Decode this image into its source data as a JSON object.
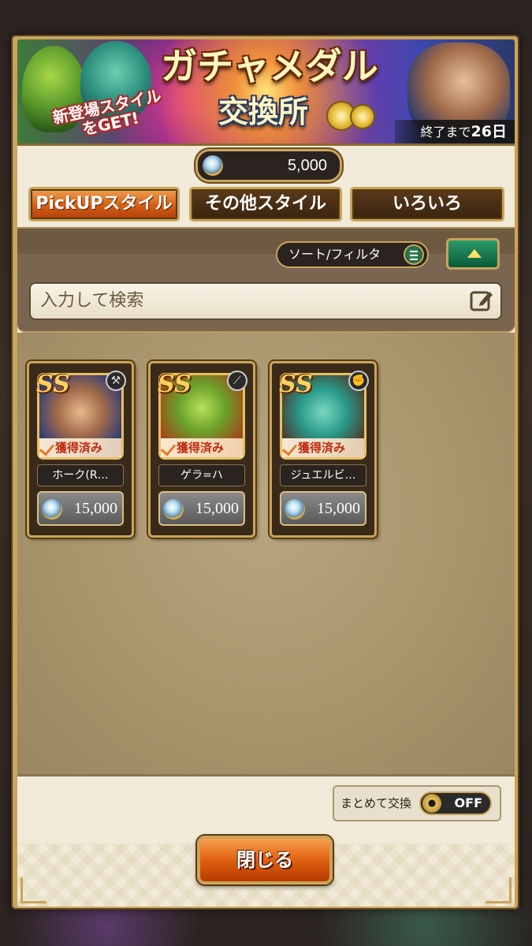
{
  "banner": {
    "title": "ガチャメダル",
    "subtitle": "交換所",
    "new_line1": "新登場スタイル",
    "new_line2": "をGET!",
    "end_label": "終了まで",
    "end_value": "26日"
  },
  "currency": {
    "icon": "medal-coin-icon",
    "value": "5,000"
  },
  "tabs": [
    {
      "label": "PickUPスタイル",
      "active": true
    },
    {
      "label": "その他スタイル",
      "active": false
    },
    {
      "label": "いろいろ",
      "active": false
    }
  ],
  "filter": {
    "sort_label": "ソート/フィルタ"
  },
  "search": {
    "placeholder": "入力して検索"
  },
  "cards": [
    {
      "rank": "SS",
      "name": "ホーク(R…",
      "status": "獲得済み",
      "price": "15,000",
      "weapon": "axe-icon"
    },
    {
      "rank": "SS",
      "name": "ゲラ=ハ",
      "status": "獲得済み",
      "price": "15,000",
      "weapon": "spear-icon"
    },
    {
      "rank": "SS",
      "name": "ジュエルビ…",
      "status": "獲得済み",
      "price": "15,000",
      "weapon": "fist-icon"
    }
  ],
  "bulk_exchange": {
    "label": "まとめて交換",
    "state": "OFF"
  },
  "close_button": {
    "label": "閉じる"
  },
  "colors": {
    "accent_orange": "#d05a10",
    "frame_gold": "#c9a45c",
    "panel_bg": "#f1ead9",
    "acquired_red": "#c02a10"
  }
}
